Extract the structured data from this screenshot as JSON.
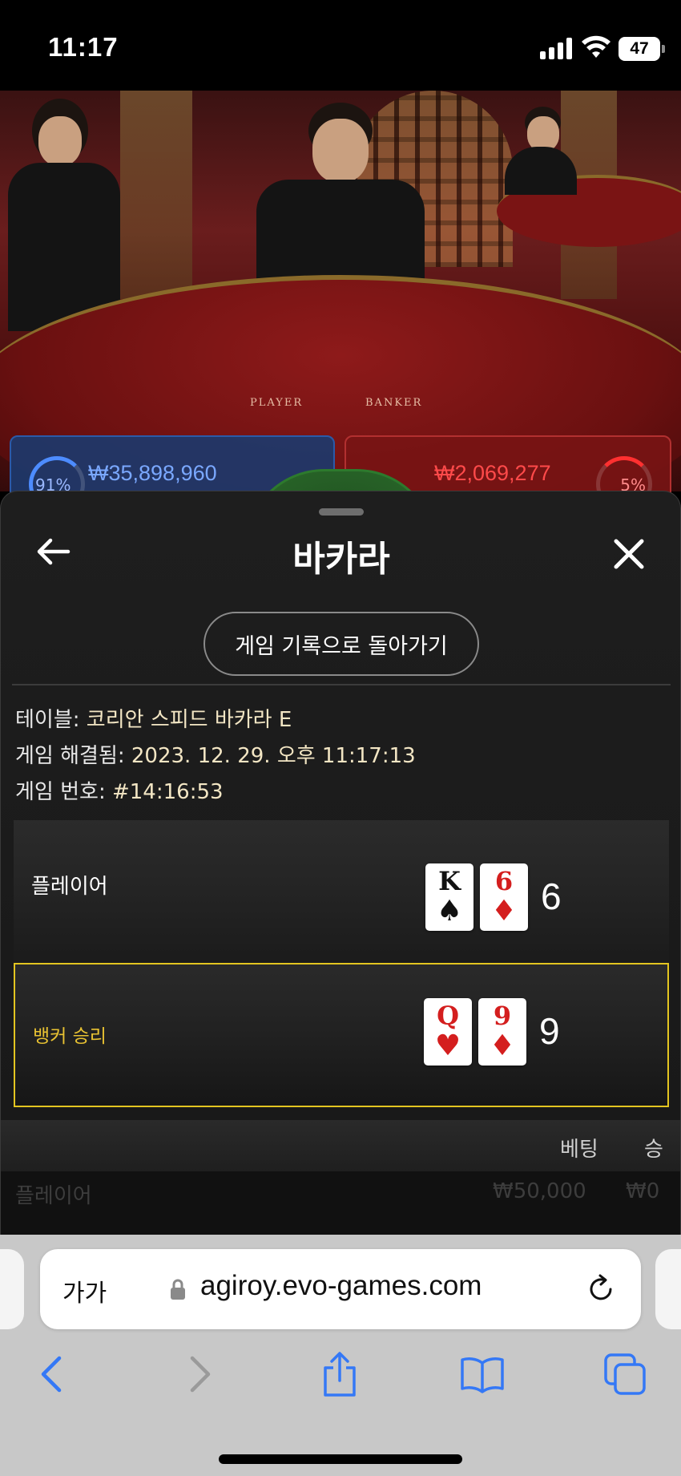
{
  "status_bar": {
    "time": "11:17",
    "battery": "47"
  },
  "video": {
    "table_label_player": "PLAYER",
    "table_label_banker": "BANKER",
    "player_bet_total": "₩35,898,960",
    "player_percent": "91%",
    "banker_bet_total": "₩2,069,277",
    "banker_percent": "5%"
  },
  "sheet": {
    "title": "바카라",
    "history_button": "게임 기록으로 돌아가기",
    "info": {
      "table_label": "테이블:",
      "table_value": "코리안 스피드 바카라 E",
      "resolved_label": "게임 해결됨:",
      "resolved_value": "2023. 12. 29. 오후 11:17:13",
      "game_number_label": "게임 번호:",
      "game_number_value": "#14:16:53"
    },
    "hands": {
      "player": {
        "label": "플레이어",
        "score": "6",
        "cards": [
          {
            "rank": "K",
            "suit": "♠",
            "color": "black"
          },
          {
            "rank": "6",
            "suit": "♦",
            "color": "red"
          }
        ]
      },
      "banker": {
        "label": "뱅커 승리",
        "score": "9",
        "cards": [
          {
            "rank": "Q",
            "suit": "♥",
            "color": "red"
          },
          {
            "rank": "9",
            "suit": "♦",
            "color": "red"
          }
        ]
      }
    },
    "bets_table": {
      "headers": {
        "bet": "베팅",
        "win": "승"
      },
      "rows": [
        {
          "type": "플레이어",
          "bet": "₩50,000",
          "win": "₩0"
        }
      ]
    }
  },
  "browser": {
    "text_size_label": "가가",
    "url": "agiroy.evo-games.com"
  },
  "colors": {
    "banker_highlight": "#e3c520",
    "player_blue": "#2b5aa8",
    "banker_red": "#b23030",
    "ios_blue": "#3478f6"
  }
}
